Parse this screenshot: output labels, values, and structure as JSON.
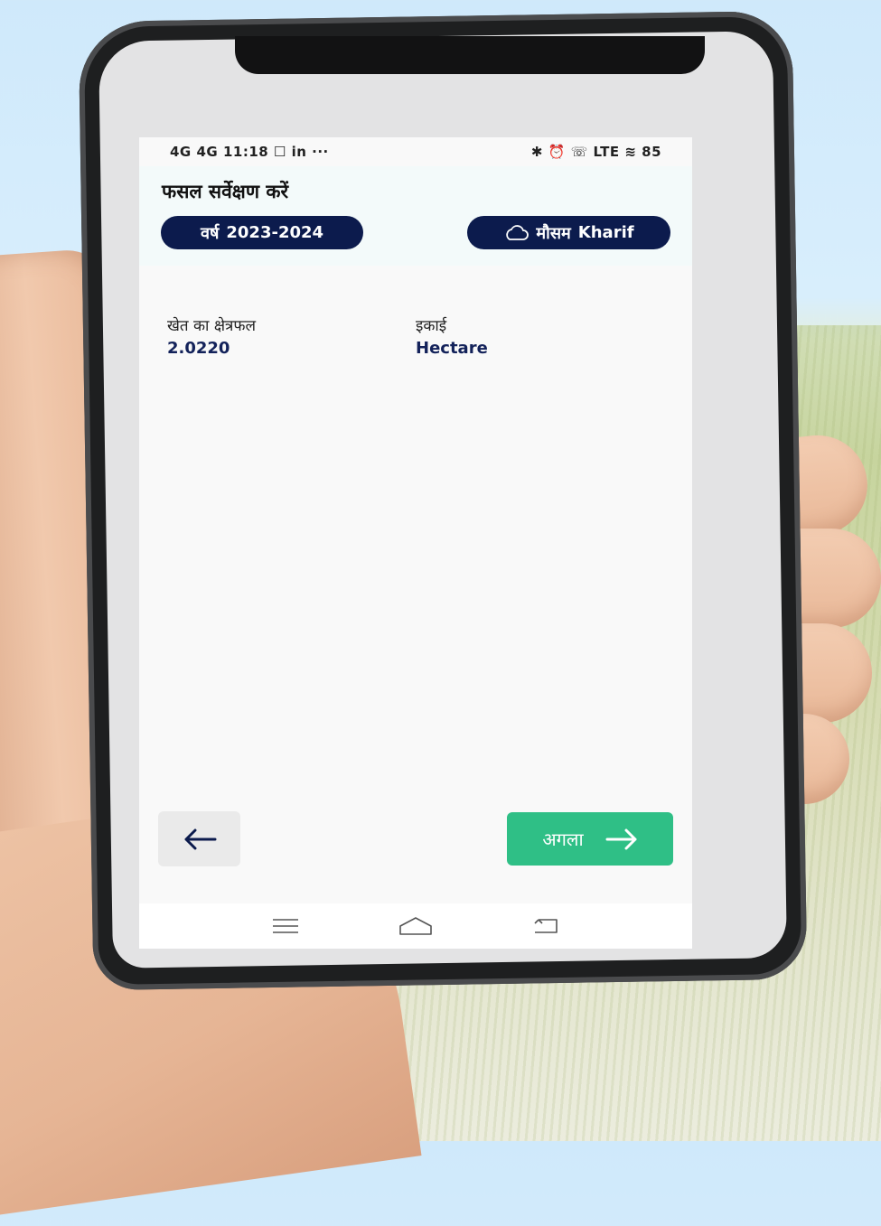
{
  "status_bar": {
    "left": "4G 4G 11:18 ☐ in ···",
    "right": "✱ ⏰ ☏ LTE ≋ 85"
  },
  "header": {
    "title": "फसल सर्वेक्षण करें",
    "year_label": "वर्ष",
    "year_value": "2023-2024",
    "season_label": "मौसम",
    "season_value": "Kharif"
  },
  "fields": {
    "area_label": "खेत का क्षेत्रफल",
    "area_value": "2.0220",
    "unit_label": "इकाई",
    "unit_value": "Hectare"
  },
  "actions": {
    "next_label": "अगला"
  },
  "colors": {
    "pill_bg": "#0c1b4d",
    "next_button": "#2fbf86",
    "value_text": "#13225a"
  },
  "icons": {
    "back": "arrow-left-icon",
    "next": "arrow-right-icon",
    "season": "cloud-icon",
    "nav_menu": "menu-icon",
    "nav_home": "home-icon",
    "nav_back": "return-icon"
  }
}
